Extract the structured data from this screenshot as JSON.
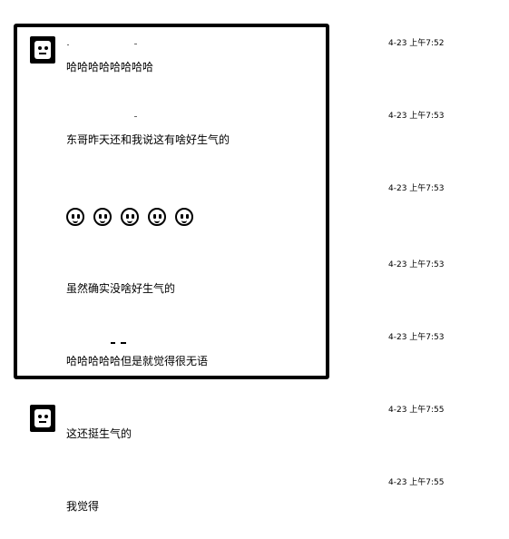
{
  "messages": [
    {
      "text": "哈哈哈哈哈哈哈哈",
      "time": "4-23 上午7:52"
    },
    {
      "text": "东哥昨天还和我说这有啥好生气的",
      "time": "4-23 上午7:53"
    },
    {
      "text": "",
      "time": "4-23 上午7:53",
      "emoji_count": 5,
      "emoji_icon": "laughing-face-icon"
    },
    {
      "text": "虽然确实没啥好生气的",
      "time": "4-23 上午7:53"
    },
    {
      "text": "哈哈哈哈哈但是就觉得很无语",
      "time": "4-23 上午7:53"
    },
    {
      "text": "这还挺生气的",
      "time": "4-23 上午7:55"
    },
    {
      "text": "我觉得",
      "time": "4-23 上午7:55"
    }
  ],
  "highlight_color": "#000000"
}
